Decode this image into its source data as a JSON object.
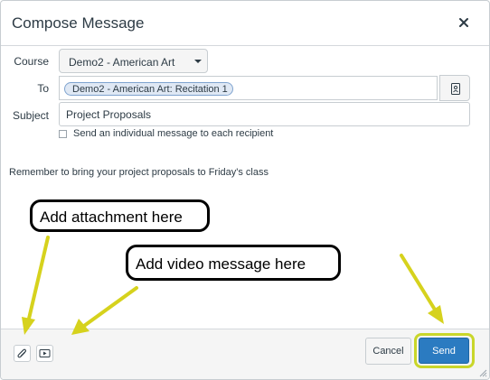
{
  "dialog": {
    "title": "Compose Message",
    "close_icon": "close-icon"
  },
  "form": {
    "course_label": "Course",
    "course_value": "Demo2 - American Art",
    "to_label": "To",
    "to_recipient": "Demo2 - American Art: Recitation 1",
    "subject_label": "Subject",
    "subject_value": "Project Proposals",
    "individual_message_label": "Send an individual message to each recipient",
    "individual_message_checked": false
  },
  "body": {
    "message": "Remember to bring your project proposals to Friday's class"
  },
  "annotations": {
    "attachment_callout": "Add attachment here",
    "video_callout": "Add video message here",
    "arrow_color": "#d6d21d"
  },
  "footer": {
    "attach_icon": "paperclip-icon",
    "video_icon": "video-icon",
    "cancel_label": "Cancel",
    "send_label": "Send"
  },
  "colors": {
    "send_button": "#2b7bc1",
    "send_highlight": "#c9d62a",
    "recipient_token": "#dfe8f4"
  }
}
